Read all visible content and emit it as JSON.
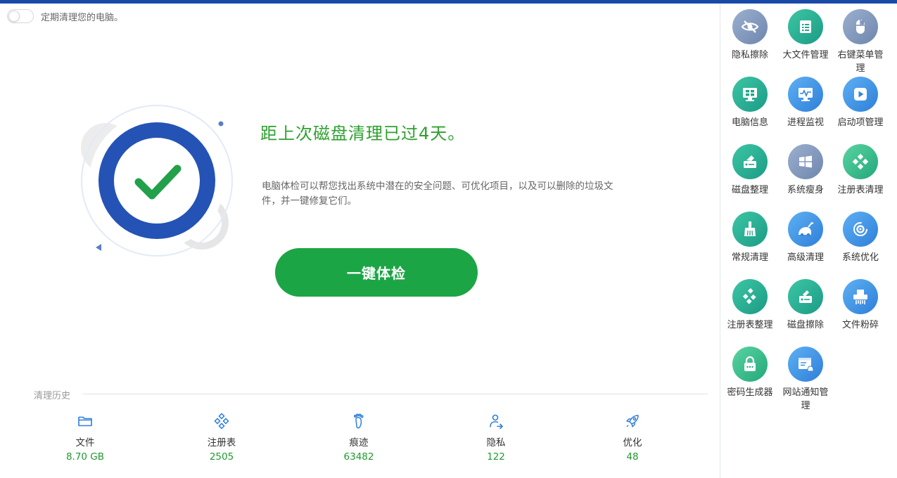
{
  "toggle": {
    "label": "定期清理您的电脑。"
  },
  "hero": {
    "headline": "距上次磁盘清理已过4天。",
    "description": "电脑体检可以帮您找出系统中潜在的安全问题、可优化项目，以及可以删除的垃圾文件，并一键修复它们。",
    "scan_button": "一键体检"
  },
  "history": {
    "title": "清理历史",
    "stats": [
      {
        "icon": "folder-icon",
        "label": "文件",
        "value": "8.70 GB"
      },
      {
        "icon": "registry-icon",
        "label": "注册表",
        "value": "2505"
      },
      {
        "icon": "footprint-icon",
        "label": "痕迹",
        "value": "63482"
      },
      {
        "icon": "privacy-user-icon",
        "label": "隐私",
        "value": "122"
      },
      {
        "icon": "rocket-icon",
        "label": "优化",
        "value": "48"
      }
    ]
  },
  "tools": [
    {
      "label": "隐私擦除",
      "icon": "eye-slash-icon"
    },
    {
      "label": "大文件管理",
      "icon": "file-list-icon"
    },
    {
      "label": "右键菜单管理",
      "icon": "mouse-icon"
    },
    {
      "label": "电脑信息",
      "icon": "monitor-grid-icon"
    },
    {
      "label": "进程监视",
      "icon": "monitor-pulse-icon"
    },
    {
      "label": "启动项管理",
      "icon": "play-icon"
    },
    {
      "label": "磁盘整理",
      "icon": "disk-icon"
    },
    {
      "label": "系统瘦身",
      "icon": "windows-icon"
    },
    {
      "label": "注册表清理",
      "icon": "registry-diamond-icon"
    },
    {
      "label": "常规清理",
      "icon": "broom-icon"
    },
    {
      "label": "高级清理",
      "icon": "vacuum-icon"
    },
    {
      "label": "系统优化",
      "icon": "gear-cycle-icon"
    },
    {
      "label": "注册表整理",
      "icon": "registry-blocks-icon"
    },
    {
      "label": "磁盘擦除",
      "icon": "disk-erase-icon"
    },
    {
      "label": "文件粉碎",
      "icon": "shredder-icon"
    },
    {
      "label": "密码生成器",
      "icon": "lock-icon"
    },
    {
      "label": "网站通知管理",
      "icon": "browser-bell-icon"
    }
  ],
  "colors": {
    "accent_blue": "#1a4aa8",
    "success_green": "#1ca545",
    "headline_green": "#2ea12e"
  }
}
